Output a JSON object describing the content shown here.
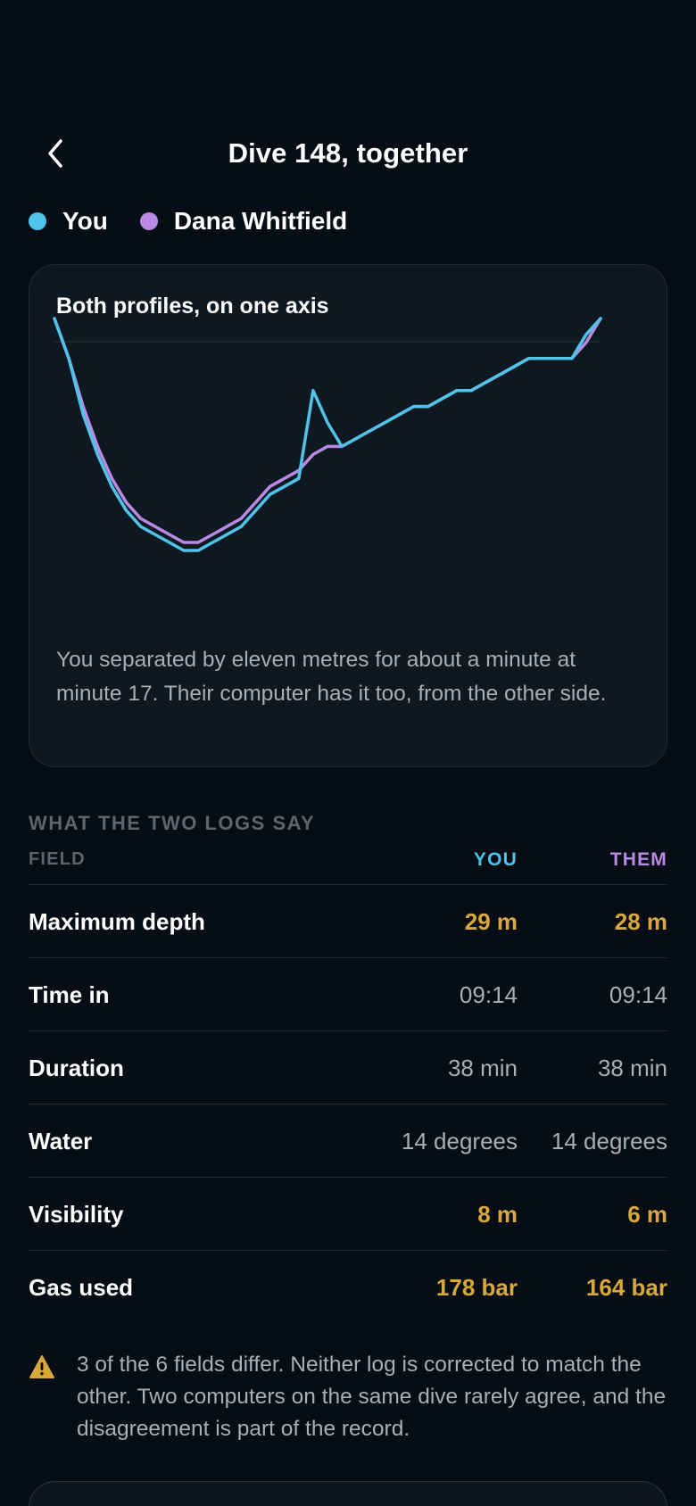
{
  "header": {
    "title": "Dive 148, together"
  },
  "legend": [
    {
      "label": "You",
      "color": "#4fc3e8"
    },
    {
      "label": "Dana Whitfield",
      "color": "#b989e4"
    }
  ],
  "chart": {
    "title": "Both profiles, on one axis",
    "note": "You separated by eleven metres for about a minute at minute 17. Their computer has it too, from the other side."
  },
  "chart_data": {
    "type": "line",
    "title": "Both profiles, on one axis",
    "xlabel": "",
    "ylabel": "",
    "xlim": [
      0,
      38
    ],
    "ylim": [
      0,
      29
    ],
    "y_inverted": true,
    "grid": false,
    "series": [
      {
        "name": "You",
        "color": "#4fc3e8",
        "x": [
          0,
          1,
          2,
          3,
          4,
          5,
          6,
          7,
          8,
          9,
          10,
          11,
          12,
          13,
          14,
          15,
          16,
          17,
          18,
          19,
          20,
          21,
          22,
          23,
          24,
          25,
          26,
          27,
          28,
          29,
          30,
          31,
          32,
          33,
          34,
          35,
          36,
          37,
          38
        ],
        "values": [
          0,
          5,
          12,
          17,
          21,
          24,
          26,
          27,
          28,
          29,
          29,
          28,
          27,
          26,
          24,
          22,
          21,
          20,
          9,
          13,
          16,
          15,
          14,
          13,
          12,
          11,
          11,
          10,
          9,
          9,
          8,
          7,
          6,
          5,
          5,
          5,
          5,
          2,
          0
        ]
      },
      {
        "name": "Dana Whitfield",
        "color": "#b989e4",
        "x": [
          0,
          1,
          2,
          3,
          4,
          5,
          6,
          7,
          8,
          9,
          10,
          11,
          12,
          13,
          14,
          15,
          16,
          17,
          18,
          19,
          20,
          21,
          22,
          23,
          24,
          25,
          26,
          27,
          28,
          29,
          30,
          31,
          32,
          33,
          34,
          35,
          36,
          37,
          38
        ],
        "values": [
          0,
          5,
          11,
          16,
          20,
          23,
          25,
          26,
          27,
          28,
          28,
          27,
          26,
          25,
          23,
          21,
          20,
          19,
          17,
          16,
          16,
          15,
          14,
          13,
          12,
          11,
          11,
          10,
          9,
          9,
          8,
          7,
          6,
          5,
          5,
          5,
          5,
          3,
          0
        ]
      }
    ]
  },
  "comparison": {
    "section_label": "WHAT THE TWO LOGS SAY",
    "headers": {
      "field": "FIELD",
      "you": "YOU",
      "them": "THEM"
    },
    "rows": [
      {
        "field": "Maximum depth",
        "you": "29 m",
        "them": "28 m",
        "differs": true
      },
      {
        "field": "Time in",
        "you": "09:14",
        "them": "09:14",
        "differs": false
      },
      {
        "field": "Duration",
        "you": "38 min",
        "them": "38 min",
        "differs": false
      },
      {
        "field": "Water",
        "you": "14 degrees",
        "them": "14 degrees",
        "differs": false
      },
      {
        "field": "Visibility",
        "you": "8 m",
        "them": "6 m",
        "differs": true
      },
      {
        "field": "Gas used",
        "you": "178 bar",
        "them": "164 bar",
        "differs": true
      }
    ]
  },
  "warning": {
    "icon": "warning-icon",
    "color": "#d9a83a",
    "text": "3 of the 6 fields differ. Neither log is corrected to match the other. Two computers on the same dive rarely agree, and the disagreement is part of the record."
  }
}
